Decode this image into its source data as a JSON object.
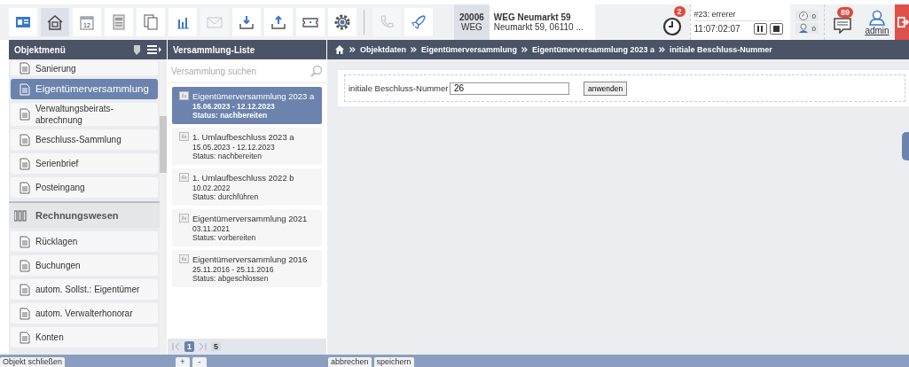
{
  "toolbar": {
    "tools": [
      {
        "selected": false,
        "disabled": false
      },
      {
        "selected": true,
        "disabled": false
      },
      {
        "selected": false,
        "disabled": false,
        "text": "12"
      },
      {
        "selected": false,
        "disabled": false
      },
      {
        "selected": false,
        "disabled": false
      },
      {
        "selected": false,
        "disabled": false
      },
      {
        "selected": false,
        "disabled": true
      },
      {
        "selected": false,
        "disabled": false
      },
      {
        "selected": false,
        "disabled": false
      },
      {
        "selected": false,
        "disabled": false
      },
      {
        "selected": false,
        "disabled": false
      }
    ],
    "extra_tools": [
      {
        "selected": false,
        "disabled": true
      },
      {
        "selected": false,
        "disabled": false
      }
    ]
  },
  "object": {
    "number": "20006",
    "type": "WEG",
    "name": "WEG Neumarkt 59",
    "address": "Neumarkt 59, 06110 ..."
  },
  "timer": {
    "badge": "2",
    "task": "#23: errerer",
    "time": "11:07:02:07",
    "counters": [
      "0",
      "0"
    ]
  },
  "messages": {
    "badge": "89"
  },
  "user": {
    "name": "admin"
  },
  "sidebar": {
    "title": "Objektmenü",
    "items": [
      {
        "kind": "item",
        "label": "Sanierung",
        "selected": false
      },
      {
        "kind": "item",
        "label": "Eigentümerversammlung",
        "selected": true
      },
      {
        "kind": "item",
        "label": "Verwaltungsbeirats-abrechnung",
        "selected": false
      },
      {
        "kind": "item",
        "label": "Beschluss-Sammlung",
        "selected": false
      },
      {
        "kind": "item",
        "label": "Serienbrief",
        "selected": false
      },
      {
        "kind": "item",
        "label": "Posteingang",
        "selected": false
      },
      {
        "kind": "section",
        "label": "Rechnungswesen",
        "selected": false
      },
      {
        "kind": "item",
        "label": "Rücklagen",
        "selected": false
      },
      {
        "kind": "item",
        "label": "Buchungen",
        "selected": false
      },
      {
        "kind": "item",
        "label": "autom. Sollst.: Eigentümer",
        "selected": false
      },
      {
        "kind": "item",
        "label": "autom. Verwalterhonorar",
        "selected": false
      },
      {
        "kind": "item",
        "label": "Konten",
        "selected": false
      }
    ],
    "footer_button": "Objekt schließen"
  },
  "list": {
    "title": "Versammlung-Liste",
    "search": {
      "placeholder": "Versammlung suchen"
    },
    "items": [
      {
        "title": "Eigentümerversammlung 2023 a",
        "dates": "15.06.2023 - 12.12.2023",
        "status": "Status: nachbereiten",
        "selected": true
      },
      {
        "title": "1. Umlaufbeschluss 2023 a",
        "dates": "15.05.2023 - 12.12.2023",
        "status": "Status: nachbereiten",
        "selected": false
      },
      {
        "title": "1. Umlaufbeschluss 2022 b",
        "dates": "10.02.2022",
        "status": "Status: durchführen",
        "selected": false
      },
      {
        "title": "Eigentümerversammlung 2021",
        "dates": "03.11.2021",
        "status": "Status: vorbereiten",
        "selected": false
      },
      {
        "title": "Eigentümerversammlung 2016",
        "dates": "25.11.2016 - 25.11.2016",
        "status": "Status: abgeschlossen",
        "selected": false
      }
    ],
    "pager": {
      "page": "1",
      "total": "5"
    },
    "footer_buttons": [
      "+",
      "-"
    ]
  },
  "breadcrumb": [
    "Objektdaten",
    "Eigentümerversammlung",
    "Eigentümerversammlung 2023 a",
    "initiale Beschluss-Nummer"
  ],
  "form": {
    "label": "initiale Beschluss-Nummer",
    "value": "26",
    "button": "anwenden"
  },
  "footer_buttons": [
    "abbrechen",
    "speichern"
  ]
}
